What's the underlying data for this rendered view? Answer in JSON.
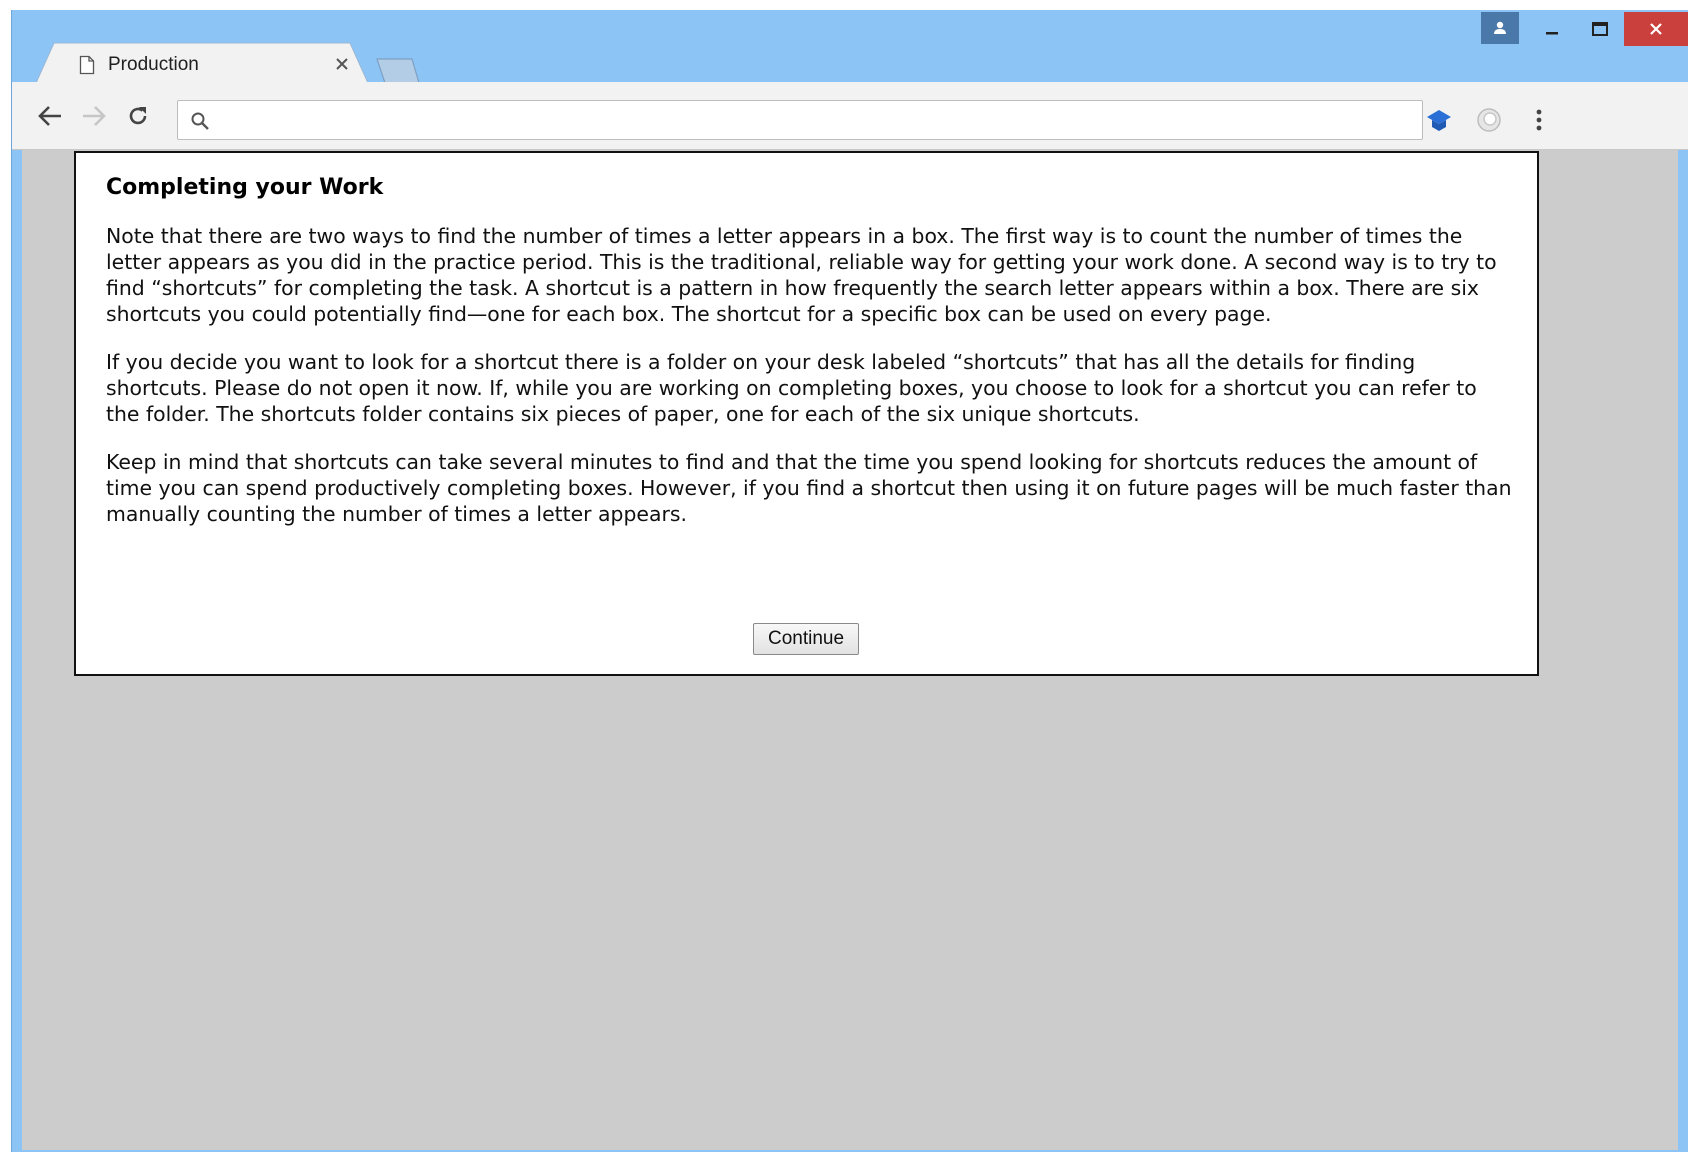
{
  "browser": {
    "tab_title": "Production",
    "address_value": "",
    "icons": {
      "tab": "page-icon",
      "tab_close": "close-icon",
      "back": "arrow-left-icon",
      "forward": "arrow-right-icon",
      "reload": "reload-icon",
      "omnibox": "search-icon",
      "extension_1": "graduation-cap-icon",
      "extension_2": "circle-extension-icon",
      "menu": "kebab-menu-icon",
      "profile": "person-icon"
    }
  },
  "page": {
    "heading": "Completing your Work",
    "paragraphs": [
      "Note that there are two ways to find the number of times a letter appears in a box. The first way is to count the number of times the letter appears as you did in the practice period. This is the traditional, reliable way for getting your work done. A second way is to try to find “shortcuts” for completing the task. A shortcut is a pattern in how frequently the search letter appears within a box. There are six shortcuts you could potentially find—one for each box. The shortcut for a specific box can be used on every page.",
      "If you decide you want to look for a shortcut there is a folder on your desk labeled “shortcuts” that has all the details for finding shortcuts. Please do not open it now. If, while you are working on completing boxes, you choose to look for a shortcut you can refer to the folder. The shortcuts folder contains six pieces of paper, one for each of the six unique shortcuts.",
      "Keep in mind that shortcuts can take several minutes to find and that the time you spend looking for shortcuts reduces the amount of time you can spend productively completing boxes. However, if you find a shortcut then using it on future pages will be much faster than manually counting the number of times a letter appears."
    ],
    "continue_label": "Continue"
  },
  "colors": {
    "titlebar": "#8cc4f6",
    "close_button": "#c9403c",
    "viewport_bg": "#cccccc"
  }
}
